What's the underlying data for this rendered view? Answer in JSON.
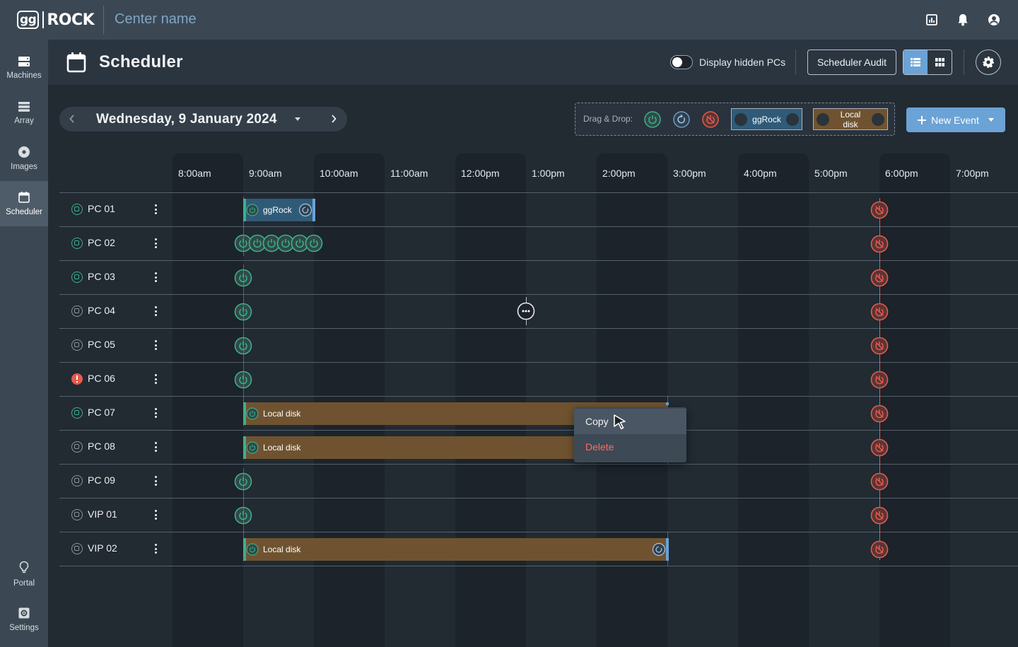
{
  "app": {
    "logo_text": "ggROCK",
    "center_name": "Center name"
  },
  "top_icons": [
    "report-icon",
    "bell-icon",
    "user-icon"
  ],
  "sidebar": {
    "items": [
      {
        "label": "Machines",
        "icon": "machines-icon"
      },
      {
        "label": "Array",
        "icon": "array-icon"
      },
      {
        "label": "Images",
        "icon": "disc-icon"
      },
      {
        "label": "Scheduler",
        "icon": "calendar-icon",
        "active": true
      }
    ],
    "bottom": [
      {
        "label": "Portal",
        "icon": "lightbulb-icon"
      },
      {
        "label": "Settings",
        "icon": "settings-icon"
      }
    ]
  },
  "header": {
    "title": "Scheduler",
    "toggle_label": "Display hidden PCs",
    "toggle_on": false,
    "audit_label": "Scheduler Audit",
    "view_mode": "list"
  },
  "date_nav": {
    "date": "Wednesday, 9 January 2024"
  },
  "dnd": {
    "label": "Drag & Drop:",
    "chip_ggrock": "ggRock",
    "chip_local": "Local disk"
  },
  "new_event": {
    "label": "New Event"
  },
  "colors": {
    "power": "#3db08a",
    "shutdown": "#e55a4f",
    "ggrock_event": "#2f5b78",
    "local_event": "#6f5330",
    "accent": "#6ba3d6",
    "danger": "#ff6b5e"
  },
  "timeline": {
    "times": [
      "8:00am",
      "9:00am",
      "10:00am",
      "11:00am",
      "12:00pm",
      "1:00pm",
      "2:00pm",
      "3:00pm",
      "4:00pm",
      "5:00pm",
      "6:00pm",
      "7:00pm"
    ]
  },
  "machines": [
    {
      "name": "PC 01",
      "status": "online"
    },
    {
      "name": "PC 02",
      "status": "online"
    },
    {
      "name": "PC 03",
      "status": "online"
    },
    {
      "name": "PC 04",
      "status": "offline"
    },
    {
      "name": "PC 05",
      "status": "offline"
    },
    {
      "name": "PC 06",
      "status": "error"
    },
    {
      "name": "PC 07",
      "status": "online"
    },
    {
      "name": "PC 08",
      "status": "offline"
    },
    {
      "name": "PC 09",
      "status": "offline"
    },
    {
      "name": "VIP 01",
      "status": "offline"
    },
    {
      "name": "VIP 02",
      "status": "offline"
    }
  ],
  "events": {
    "ggrock_label": "ggRock",
    "local_label": "Local disk"
  },
  "context_menu": {
    "copy": "Copy",
    "delete": "Delete"
  }
}
